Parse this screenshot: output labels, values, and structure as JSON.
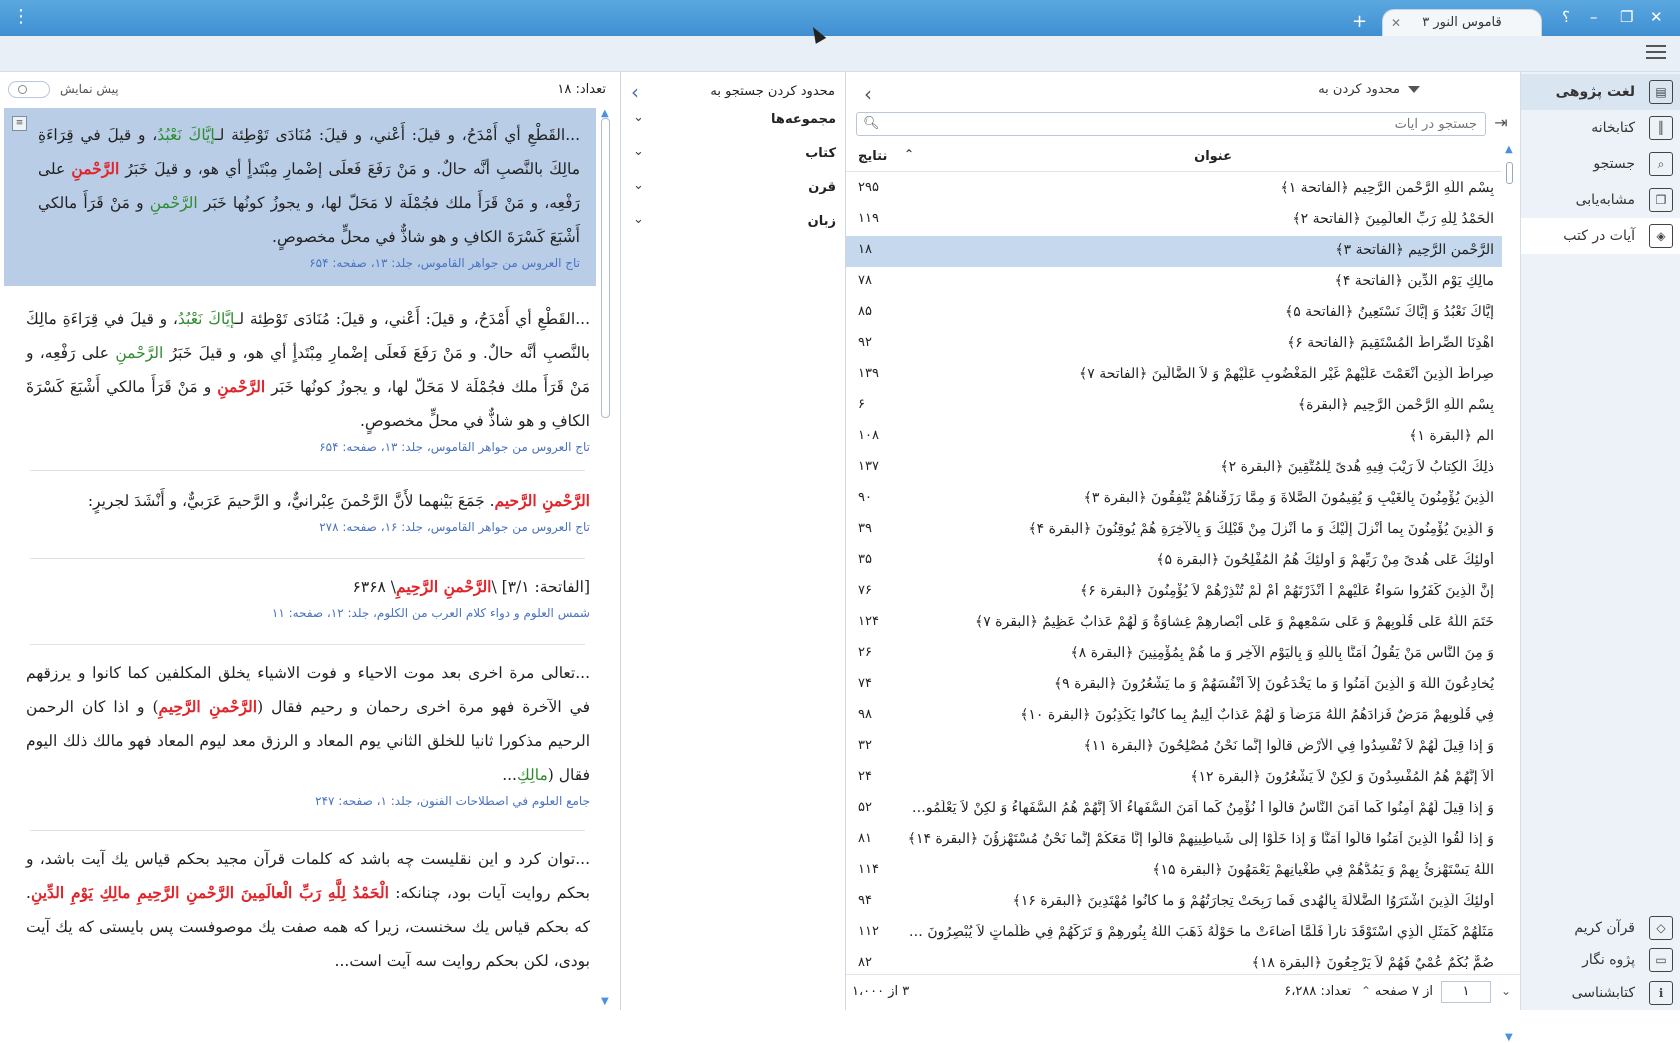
{
  "titlebar": {
    "tab_title": "قاموس النور ۳",
    "help": "؟",
    "minimize": "–",
    "maximize": "❐",
    "close": "✕",
    "new_tab": "+",
    "menu": "⋮"
  },
  "sidebar": {
    "items": [
      {
        "label": "لغت پژوهی",
        "icon": "dictionary-icon"
      },
      {
        "label": "کتابخانه",
        "icon": "library-icon"
      },
      {
        "label": "جستجو",
        "icon": "search-icon"
      },
      {
        "label": "مشابه‌یابی",
        "icon": "similarity-icon"
      },
      {
        "label": "آیات در کتب",
        "icon": "verses-in-books-icon"
      }
    ],
    "bottom_items": [
      {
        "label": "قرآن کریم",
        "icon": "quran-icon"
      },
      {
        "label": "پژوه نگار",
        "icon": "notes-icon"
      },
      {
        "label": "کتابشناسی",
        "icon": "bibliography-icon"
      }
    ]
  },
  "list": {
    "limit_label": "محدود کردن به",
    "search_placeholder": "جستجو در آیات",
    "col_title": "عنوان",
    "col_results": "نتایج",
    "rows": [
      {
        "title": "بِسْمِ اللَّهِ الرَّحْمنِ الرَّحِيمِ ﴿الفاتحة ۱﴾",
        "count": "۲۹۵"
      },
      {
        "title": "الْحَمْدُ لِلَّهِ رَبِّ الْعالَمِينَ ﴿الفاتحة ۲﴾",
        "count": "۱۱۹"
      },
      {
        "title": "الرَّحْمنِ الرَّحِيمِ ﴿الفاتحة ۳﴾",
        "count": "۱۸"
      },
      {
        "title": "مالِكِ يَوْمِ الدِّينِ ﴿الفاتحة ۴﴾",
        "count": "۷۸"
      },
      {
        "title": "إِيَّاكَ نَعْبُدُ وَ إِيَّاكَ نَسْتَعِينُ ﴿الفاتحة ۵﴾",
        "count": "۸۵"
      },
      {
        "title": "اهْدِنَا الصِّراطَ الْمُسْتَقِيمَ ﴿الفاتحة ۶﴾",
        "count": "۹۲"
      },
      {
        "title": "صِراطَ الَّذِينَ أَنْعَمْتَ عَلَيْهِمْ غَيْرِ الْمَغْضُوبِ عَلَيْهِمْ وَ لاَ الضَّالِّينَ ﴿الفاتحة ۷﴾",
        "count": "۱۳۹"
      },
      {
        "title": "بِسْمِ اللَّهِ الرَّحْمنِ الرَّحِيمِ ﴿البقرة﴾",
        "count": "۶"
      },
      {
        "title": "الم ﴿البقرة ۱﴾",
        "count": "۱۰۸"
      },
      {
        "title": "ذلِكَ الْكِتابُ لاَ رَيْبَ فِيهِ هُدىً لِلْمُتَّقِينَ ﴿البقرة ۲﴾",
        "count": "۱۳۷"
      },
      {
        "title": "الَّذِينَ يُؤْمِنُونَ بِالْغَيْبِ وَ يُقِيمُونَ الصَّلاةَ وَ مِمَّا رَزَقْناهُمْ يُنْفِقُونَ ﴿البقرة ۳﴾",
        "count": "۹۰"
      },
      {
        "title": "وَ الَّذِينَ يُؤْمِنُونَ بِما أُنْزِلَ إِلَيْكَ وَ ما أُنْزِلَ مِنْ قَبْلِكَ وَ بِالْآخِرَةِ هُمْ يُوقِنُونَ ﴿البقرة ۴﴾",
        "count": "۳۹"
      },
      {
        "title": "أُولئِكَ عَلى هُدىً مِنْ رَبِّهِمْ وَ أُولئِكَ هُمُ الْمُفْلِحُونَ ﴿البقرة ۵﴾",
        "count": "۳۵"
      },
      {
        "title": "إِنَّ الَّذِينَ كَفَرُوا سَواءٌ عَلَيْهِمْ أَ أَنْذَرْتَهُمْ أَمْ لَمْ تُنْذِرْهُمْ لاَ يُؤْمِنُونَ ﴿البقرة ۶﴾",
        "count": "۷۶"
      },
      {
        "title": "خَتَمَ اللَّهُ عَلى قُلُوبِهِمْ وَ عَلى سَمْعِهِمْ وَ عَلى أَبْصارِهِمْ غِشاوَةٌ وَ لَهُمْ عَذابٌ عَظِيمٌ ﴿البقرة ۷﴾",
        "count": "۱۲۴"
      },
      {
        "title": "وَ مِنَ النَّاسِ مَنْ يَقُولُ آمَنَّا بِاللَّهِ وَ بِالْيَوْمِ الْآخِرِ وَ ما هُمْ بِمُؤْمِنِينَ ﴿البقرة ۸﴾",
        "count": "۲۶"
      },
      {
        "title": "يُخادِعُونَ اللَّهَ وَ الَّذِينَ آمَنُوا وَ ما يَخْدَعُونَ إِلاَّ أَنْفُسَهُمْ وَ ما يَشْعُرُونَ ﴿البقرة ۹﴾",
        "count": "۷۴"
      },
      {
        "title": "فِي قُلُوبِهِمْ مَرَضٌ فَزادَهُمُ اللَّهُ مَرَضاً وَ لَهُمْ عَذابٌ أَلِيمٌ بِما كانُوا يَكْذِبُونَ ﴿البقرة ۱۰﴾",
        "count": "۹۸"
      },
      {
        "title": "وَ إِذا قِيلَ لَهُمْ لاَ تُفْسِدُوا فِي الْأَرْضِ قالُوا إِنَّما نَحْنُ مُصْلِحُونَ ﴿البقرة ۱۱﴾",
        "count": "۳۲"
      },
      {
        "title": "أَلاَ إِنَّهُمْ هُمُ الْمُفْسِدُونَ وَ لكِنْ لاَ يَشْعُرُونَ ﴿البقرة ۱۲﴾",
        "count": "۲۴"
      },
      {
        "title": "وَ إِذا قِيلَ لَهُمْ آمِنُوا كَما آمَنَ النَّاسُ قالُوا أَ نُؤْمِنُ كَما آمَنَ السُّفَهاءُ أَلاَ إِنَّهُمْ هُمُ السُّفَهاءُ وَ لكِنْ لاَ يَعْلَمُونَ ﴿البقر...",
        "count": "۵۲"
      },
      {
        "title": "وَ إِذا لَقُوا الَّذِينَ آمَنُوا قالُوا آمَنَّا وَ إِذا خَلَوْا إِلى شَياطِينِهِمْ قالُوا إِنَّا مَعَكُمْ إِنَّما نَحْنُ مُسْتَهْزِؤُنَ ﴿البقرة ۱۴﴾",
        "count": "۸۱"
      },
      {
        "title": "اللَّهُ يَسْتَهْزِئُ بِهِمْ وَ يَمُدُّهُمْ فِي طُغْيانِهِمْ يَعْمَهُونَ ﴿البقرة ۱۵﴾",
        "count": "۱۱۴"
      },
      {
        "title": "أُولئِكَ الَّذِينَ اشْتَرَوُا الضَّلالَةَ بِالْهُدى فَما رَبِحَتْ تِجارَتُهُمْ وَ ما كانُوا مُهْتَدِينَ ﴿البقرة ۱۶﴾",
        "count": "۹۴"
      },
      {
        "title": "مَثَلُهُمْ كَمَثَلِ الَّذِي اسْتَوْقَدَ ناراً فَلَمَّا أَضاءَتْ ما حَوْلَهُ ذَهَبَ اللَّهُ بِنُورِهِمْ وَ تَرَكَهُمْ فِي ظُلُماتٍ لاَ يُبْصِرُونَ ﴿البقرة...",
        "count": "۱۱۲"
      },
      {
        "title": "صُمٌّ بُكْمٌ عُمْيٌ فَهُمْ لاَ يَرْجِعُونَ ﴿البقرة ۱۸﴾",
        "count": "۸۲"
      }
    ],
    "pager": {
      "page": "۱",
      "of_pages": "از ۷ صفحه",
      "count": "تعداد: ۶،۲۸۸",
      "range": "۳ از ۱،۰۰۰"
    }
  },
  "filter": {
    "title": "محدود کردن جستجو به",
    "facets": [
      "مجموعه‌ها",
      "کتاب",
      "قرن",
      "زبان"
    ]
  },
  "results": {
    "count": "تعداد: ۱۸",
    "preview_label": "پیش نمایش",
    "entries": [
      {
        "parts": [
          {
            "t": "...القَطْعِ أي أَمْدَحُ، و قيلَ: أَعْني، و قيلَ: مُنَادَى تَوْطِئة لـ",
            "c": ""
          },
          {
            "t": "إيَّاكَ نَعْبُدُ",
            "c": "g"
          },
          {
            "t": "، و قيلَ في قِرَاءَةِ مالِكَ بالنَّصبِ أنَّه حالٌ. و مَنْ رَفَعَ فَعلَى إضْمارِ مِبْتَدأٍ أي هو، و قيلَ خَبَرُ ",
            "c": ""
          },
          {
            "t": "الرَّحْمنِ",
            "c": "r"
          },
          {
            "t": " على رَفْعِه، و مَنْ قَرَأَ ملك فجُمْلَة لا مَحَلّ لها، و يجوزُ كونُها خَبَر ",
            "c": ""
          },
          {
            "t": "الرَّحْمنِ",
            "c": "g"
          },
          {
            "t": " و مَنْ قَرَأَ مالكي أَشْبَعَ كَسْرَةَ الكافِ و هو شاذٌّ في محلٍّ مخصوصٍ.",
            "c": ""
          }
        ],
        "source": "تاج العروس من جواهر القاموس، جلد: ۱۳، صفحه: ۶۵۴"
      },
      {
        "parts": [
          {
            "t": "...القَطْعِ أي أَمْدَحُ، و قيلَ: أَعْني، و قيلَ: مُنَادَى تَوْطِئة لـ",
            "c": ""
          },
          {
            "t": "إيَّاكَ نَعْبُدُ",
            "c": "g"
          },
          {
            "t": "، و قيلَ في قِرَاءَةِ مالِكَ بالنَّصبِ أنَّه حالٌ. و مَنْ رَفَعَ فَعلَى إضْمارِ مِبْتَدأٍ أي هو، و قيلَ خَبَرُ ",
            "c": ""
          },
          {
            "t": "الرَّحْمنِ",
            "c": "g"
          },
          {
            "t": " على رَفْعِه، و مَنْ قَرَأَ ملك فجُمْلَة لا مَحَلّ لها، و يجوزُ كونُها خَبَر ",
            "c": ""
          },
          {
            "t": "الرَّحْمنِ",
            "c": "r"
          },
          {
            "t": " و مَنْ قَرَأَ مالكي أَشْبَعَ كَسْرَةَ الكافِ و هو شاذٌّ في محلٍّ مخصوصٍ.",
            "c": ""
          }
        ],
        "source": "تاج العروس من جواهر القاموس، جلد: ۱۳، صفحه: ۶۵۴"
      },
      {
        "parts": [
          {
            "t": "الرَّحْمنِ الرَّحيم",
            "c": "r"
          },
          {
            "t": ". جَمَعَ بَيْنهما لأَنَّ الرَّحْمنَ عِبْرانيٌّ، و الرَّحيمَ عَرَبيٌّ، و أَنْشَدَ لجريرٍ:",
            "c": ""
          }
        ],
        "source": "تاج العروس من جواهر القاموس، جلد: ۱۶، صفحه: ۲۷۸"
      },
      {
        "parts": [
          {
            "t": "[الفاتحة: ۳/۱] \\",
            "c": ""
          },
          {
            "t": "الرَّحْمنِ الرَّحِيمِ",
            "c": "r"
          },
          {
            "t": "\\ ۶۳۶۸",
            "c": ""
          }
        ],
        "source": "شمس العلوم و دواء كلام العرب من الكلوم، جلد: ۱۲، صفحه: ۱۱"
      },
      {
        "parts": [
          {
            "t": "...تعالى مرة اخرى بعد موت الاحياء و فوت الاشياء يخلق المكلفين كما كانوا و يرزقهم في الآخرة فهو مرة اخرى رحمان و رحيم فقال (",
            "c": ""
          },
          {
            "t": "الرَّحْمنِ الرَّحِيمِ",
            "c": "r"
          },
          {
            "t": ") و اذا كان الرحمن الرحيم مذكورا ثانيا للخلق الثاني يوم المعاد و الرزق معد ليوم المعاد فهو مالك ذلك اليوم فقال (",
            "c": ""
          },
          {
            "t": "مالِكِ",
            "c": "g"
          },
          {
            "t": "...",
            "c": ""
          }
        ],
        "source": "جامع العلوم في اصطلاحات الفنون، جلد: ۱، صفحه: ۲۴۷"
      },
      {
        "parts": [
          {
            "t": "...توان كرد و اين نقليست چه باشد كه كلمات قرآن مجيد بحكم قياس يك آيت باشد، و بحكم روايت آيات بود، چنانكه: ",
            "c": ""
          },
          {
            "t": "الْحَمْدُ لِلَّهِ رَبِّ الْعالَمِينَ الرَّحْمنِ الرَّحِيمِ مالِكِ يَوْمِ الدِّينِ",
            "c": "r"
          },
          {
            "t": ". كه بحكم قياس يك سخنست، زيرا كه همه صفت يك موصوفست پس بايستى كه يك آيت بودى، لكن بحكم روايت سه آيت است...",
            "c": ""
          }
        ],
        "source": ""
      }
    ]
  },
  "colors": {
    "titlebar": "#4a9ad8",
    "selection": "#c6d8ee",
    "highlight_red": "#e0262b",
    "highlight_green": "#2e8b2e",
    "source_link": "#4a74c0"
  }
}
